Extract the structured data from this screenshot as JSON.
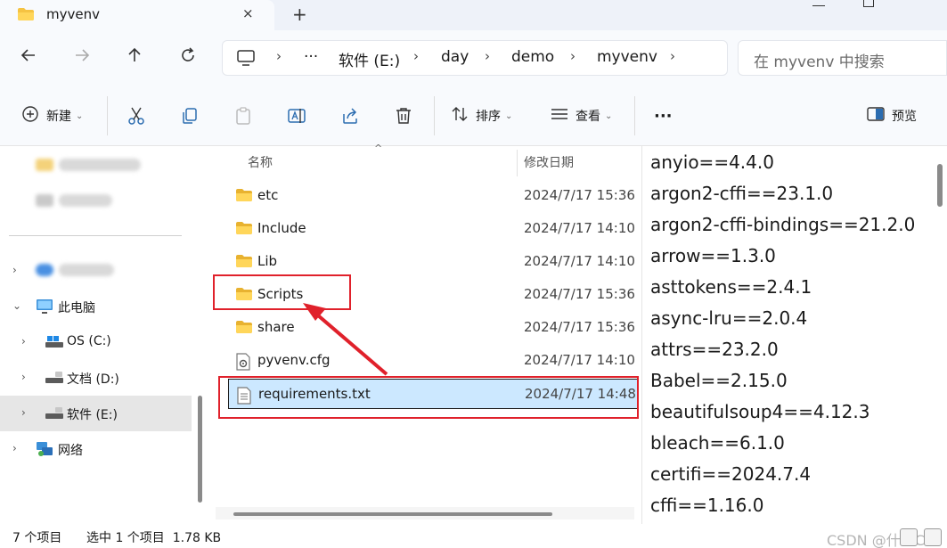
{
  "window": {
    "tab_title": "myvenv",
    "tab_close_icon": "×",
    "new_tab_icon": "+"
  },
  "address": {
    "breadcrumbs": [
      "软件 (E:)",
      "day",
      "demo",
      "myvenv"
    ],
    "overflow": "···",
    "search_placeholder": "在 myvenv 中搜索"
  },
  "toolbar": {
    "new_label": "新建",
    "sort_label": "排序",
    "view_label": "查看",
    "more_label": "···",
    "preview_label": "预览"
  },
  "sidebar": {
    "items": [
      {
        "label": "此电脑",
        "icon": "computer-icon"
      },
      {
        "label": "OS (C:)",
        "icon": "drive-icon"
      },
      {
        "label": "文档 (D:)",
        "icon": "drive-icon"
      },
      {
        "label": "软件 (E:)",
        "icon": "drive-icon"
      },
      {
        "label": "网络",
        "icon": "network-icon"
      }
    ]
  },
  "filelist": {
    "col_name": "名称",
    "col_date": "修改日期",
    "rows": [
      {
        "name": "etc",
        "date": "2024/7/17 15:36",
        "type": "folder"
      },
      {
        "name": "Include",
        "date": "2024/7/17 14:10",
        "type": "folder"
      },
      {
        "name": "Lib",
        "date": "2024/7/17 14:10",
        "type": "folder"
      },
      {
        "name": "Scripts",
        "date": "2024/7/17 15:36",
        "type": "folder"
      },
      {
        "name": "share",
        "date": "2024/7/17 15:36",
        "type": "folder"
      },
      {
        "name": "pyvenv.cfg",
        "date": "2024/7/17 14:10",
        "type": "config"
      },
      {
        "name": "requirements.txt",
        "date": "2024/7/17 14:48",
        "type": "text"
      }
    ]
  },
  "preview": {
    "lines": [
      "anyio==4.4.0",
      "argon2-cffi==23.1.0",
      "argon2-cffi-bindings==21.2.0",
      "arrow==1.3.0",
      "asttokens==2.4.1",
      "async-lru==2.0.4",
      "attrs==23.2.0",
      "Babel==2.15.0",
      "beautifulsoup4==4.12.3",
      "bleach==6.1.0",
      "certifi==2024.7.4",
      "cffi==1.16.0"
    ]
  },
  "status": {
    "item_count": "7 个项目",
    "selection": "选中 1 个项目  1.78 KB",
    "watermark": "CSDN @什么C"
  },
  "colors": {
    "annotation_red": "#e0212b",
    "selection_blue": "#cce8ff",
    "folder_yellow": "#f5c342"
  }
}
